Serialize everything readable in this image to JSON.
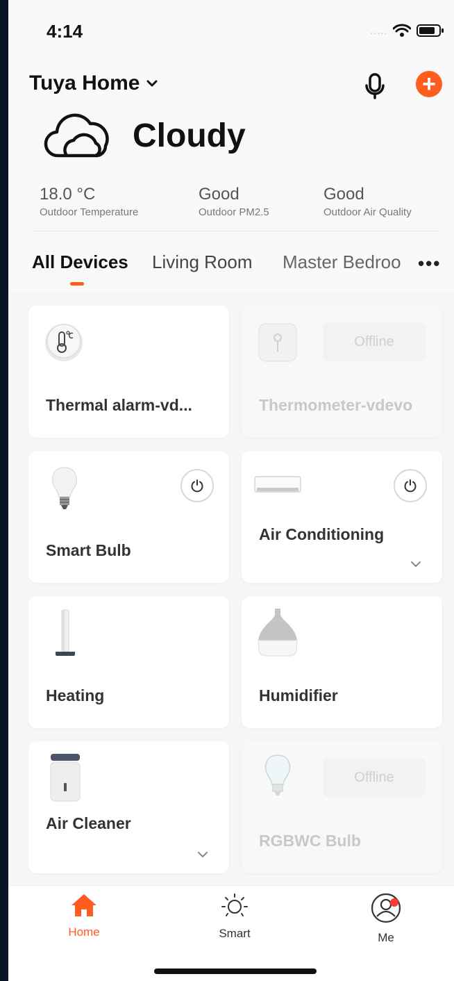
{
  "status_bar": {
    "time": "4:14",
    "signal": "....."
  },
  "header": {
    "home_name": "Tuya Home",
    "add_symbol": "+"
  },
  "weather": {
    "condition": "Cloudy",
    "stats": [
      {
        "value": "18.0 °C",
        "label": "Outdoor Temperature"
      },
      {
        "value": "Good",
        "label": "Outdoor PM2.5"
      },
      {
        "value": "Good",
        "label": "Outdoor Air Quality"
      }
    ]
  },
  "tabs": {
    "items": [
      "All Devices",
      "Living Room",
      "Master Bedroo"
    ],
    "more": "•••",
    "active": "All Devices"
  },
  "devices": [
    {
      "name": "Thermal alarm-vd...",
      "icon": "thermal-alarm-icon",
      "online": true
    },
    {
      "name": "Thermometer-vdevo",
      "icon": "thermometer-icon",
      "online": false,
      "badge": "Offline"
    },
    {
      "name": "Smart Bulb",
      "icon": "bulb-icon",
      "online": true
    },
    {
      "name": "Air Conditioning",
      "icon": "air-conditioner-icon",
      "online": true
    },
    {
      "name": "Heating",
      "icon": "heater-icon",
      "online": true
    },
    {
      "name": "Humidifier",
      "icon": "humidifier-icon",
      "online": true
    },
    {
      "name": "Air Cleaner",
      "icon": "air-cleaner-icon",
      "online": true
    },
    {
      "name": "RGBWC Bulb",
      "icon": "rgbwc-bulb-icon",
      "online": false,
      "badge": "Offline"
    }
  ],
  "tabbar": {
    "home": "Home",
    "smart": "Smart",
    "me": "Me"
  },
  "colors": {
    "accent": "#ff5c1f",
    "badge": "#ff3b30"
  }
}
